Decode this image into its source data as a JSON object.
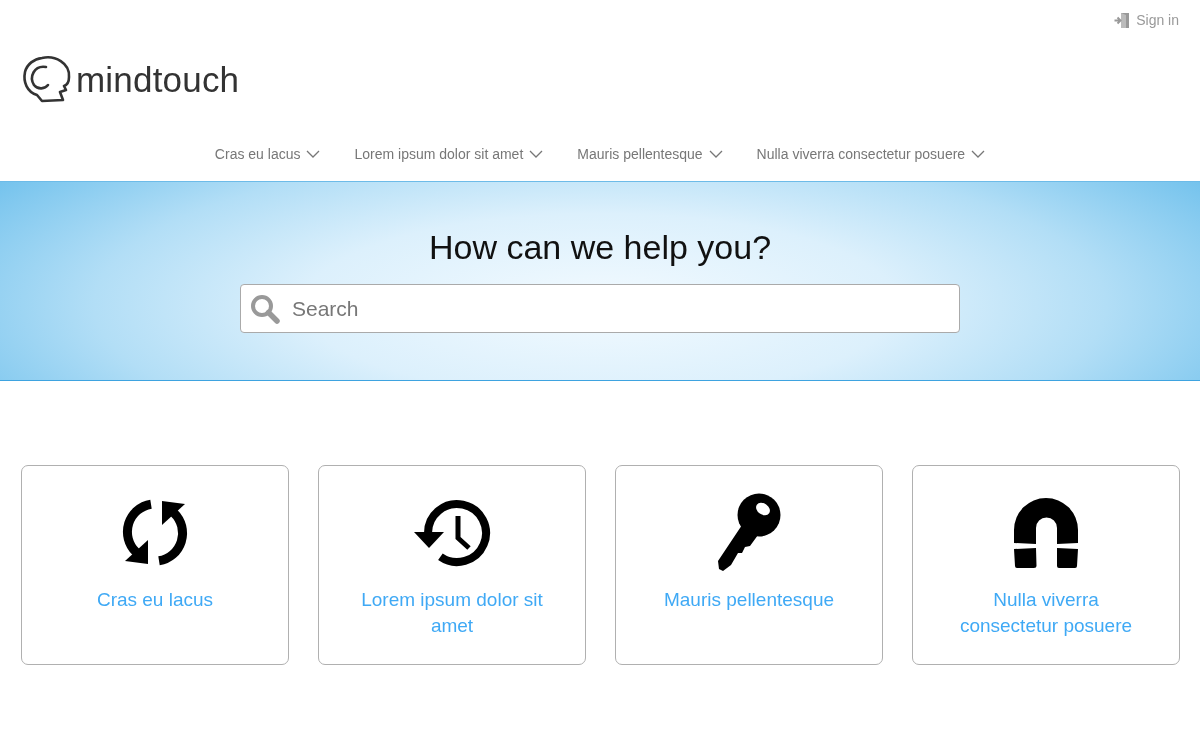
{
  "header": {
    "sign_in": "Sign in",
    "logo_text": "mindtouch"
  },
  "nav": [
    {
      "label": "Cras eu lacus",
      "expanded": false
    },
    {
      "label": "Lorem ipsum dolor sit amet",
      "expanded": false
    },
    {
      "label": "Mauris pellentesque",
      "expanded": false
    },
    {
      "label": "Nulla viverra consectetur posuere",
      "expanded": false
    }
  ],
  "hero": {
    "title": "How can we help you?",
    "search": {
      "placeholder": "Search"
    }
  },
  "categories": [
    {
      "label": "Cras eu lacus"
    },
    {
      "label": "Lorem ipsum dolor sit amet"
    },
    {
      "label": "Mauris pellentesque"
    },
    {
      "label": "Nulla viverra consectetur posuere"
    }
  ]
}
